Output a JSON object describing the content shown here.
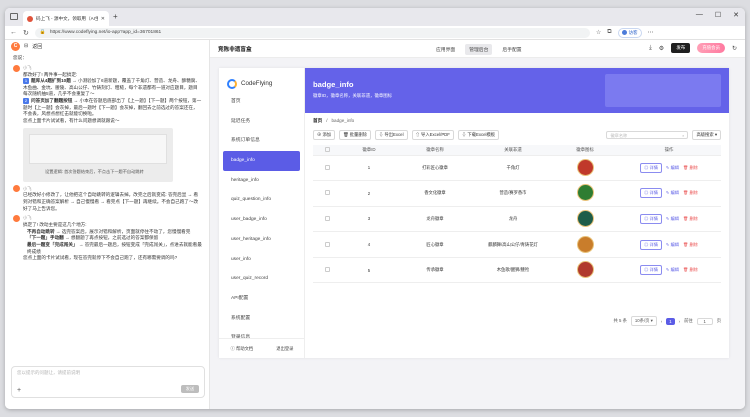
{
  "browser": {
    "tab_title": "码上飞 - 源中文，领取用（AI生态）",
    "url": "https://www.codeflying.net/io-app?app_id=36701861",
    "guest_label": "访客"
  },
  "chat": {
    "back_label": "返回",
    "messages": [
      {
        "who": "",
        "lines": [
          "您说："
        ]
      },
      {
        "who": "小飞",
        "lines": [
          "都改好了! 两件事一起搞定:"
        ]
      },
      {
        "num": "1",
        "bold": "题库从4题扩到10题",
        "rest": " → 小测验加了6道新题，覆盖了千角灯、营造、龙舟、酥糖腐、木鱼曲、金坑、腰陵、高山公仔、竹铸刻灯、粗糙，每个非遗都有一道对应题目，题目每次随机抽5道，几乎不会重复了～"
      },
      {
        "num": "2",
        "bold": "问答页加了翻题按钮",
        "rest": " → 小本在答题后底部出了【上一题】【下一题】两个按钮，第一题时【上一题】会灰掉，最后一题时【下一题】会灰掉，翻回去之前选过的答案还在，不会丢，风想点想红击就能切换啦。"
      },
      {
        "plain": "您点上面卡片试试看，有什么问题想调就跟说～"
      }
    ],
    "screenshot_caption": "设置逻辑: 首次答题结束后，不点击下一题不自动跳转",
    "messages2": [
      {
        "who": "小飞",
        "lines": [
          "已经改好小修改了，让他把这个自动跳转的逻辑去掉。改完之后就变成: 答完后显 → 看到对错和正确答案解析 → 自己慢慢看 → 看完点【下一题】再继续。不会自己跑了～改好了马上告诉您。"
        ]
      },
      {
        "who": "小飞",
        "lines": [
          "搞定了! 改动主要是这几个地方:"
        ]
      }
    ],
    "bullets": [
      {
        "bold": "不再自动跳转",
        "rest": " → 选完答案后，展示对错和解析，页面就停住不动了，您慢慢看完"
      },
      {
        "bold": "「下一题」手动翻",
        "rest": " → 想翻题了再点按钮，之前选过的答案都保留"
      },
      {
        "bold": "最后一题变「完成闯关」",
        "rest": " → 答完最后一题后，按钮变成「完成闯关」，点进去就能看最终成绩"
      }
    ],
    "closing": "您点上面的卡片试试看，现在答完就停下不会自己跑了，还有哪需要调的吗?",
    "input_placeholder": "您以提示的问题让，请提前说明",
    "send_label": "发送"
  },
  "app_header": {
    "title": "竞陈非遗盲盒",
    "tabs": [
      "应用界面",
      "管理后台",
      "后手配置"
    ],
    "active_tab": 1,
    "publish_label": "发布",
    "member_label": "充值会员"
  },
  "sidebar": {
    "brand": "CodeFlying",
    "items": [
      "首页",
      "延迟任务",
      "系统订单信息",
      "badge_info",
      "heritage_info",
      "quiz_question_info",
      "user_badge_info",
      "user_heritage_info",
      "user_info",
      "user_quiz_record",
      "API配置",
      "系统配置",
      "登录信息"
    ],
    "active_index": 3,
    "help_label": "帮助文档",
    "logout_label": "退出登录"
  },
  "content": {
    "hero_title": "badge_info",
    "hero_subtitle": "徽章ID，徽章名称，关联非遗，徽章图标",
    "breadcrumb_home": "首页",
    "breadcrumb_sep": "/",
    "breadcrumb_current": "badge_info",
    "toolbar": {
      "add": "⊕ 添加",
      "batch_delete": "🗑 批量删除",
      "export_excel": "⇩ 导出Excel",
      "import_excel_pdf": "⇧ 导入Excel/PDF",
      "download_template": "⇩ 下载Excel模板",
      "search_placeholder": "徽章名称",
      "advanced_search": "高级搜索"
    },
    "columns": [
      "徽章ID",
      "徽章名称",
      "关联非遗",
      "徽章图标",
      "操作"
    ],
    "rows": [
      {
        "id": "1",
        "name": "打彩匠心徽章",
        "heritage": "千角灯",
        "color": "#c0392b"
      },
      {
        "id": "2",
        "name": "香文化徽章",
        "heritage": "营造/赛罗香市",
        "color": "#2e7d32"
      },
      {
        "id": "3",
        "name": "龙舟徽章",
        "heritage": "龙舟",
        "color": "#1e5d4a"
      },
      {
        "id": "4",
        "name": "匠心徽章",
        "heritage": "麒麟舞/高山公仔/青铸花灯",
        "color": "#c97d2b"
      },
      {
        "id": "5",
        "name": "传承徽章",
        "heritage": "木鱼歌/醒狮/腰殓",
        "color": "#b03a2e"
      }
    ],
    "row_actions": {
      "detail": "详情",
      "edit": "编辑",
      "delete": "删除"
    },
    "pagination": {
      "total": "共 5 条",
      "page_size": "10条/页",
      "current_page": "1",
      "goto_label": "前往",
      "goto_value": "1",
      "page_unit": "页"
    }
  }
}
